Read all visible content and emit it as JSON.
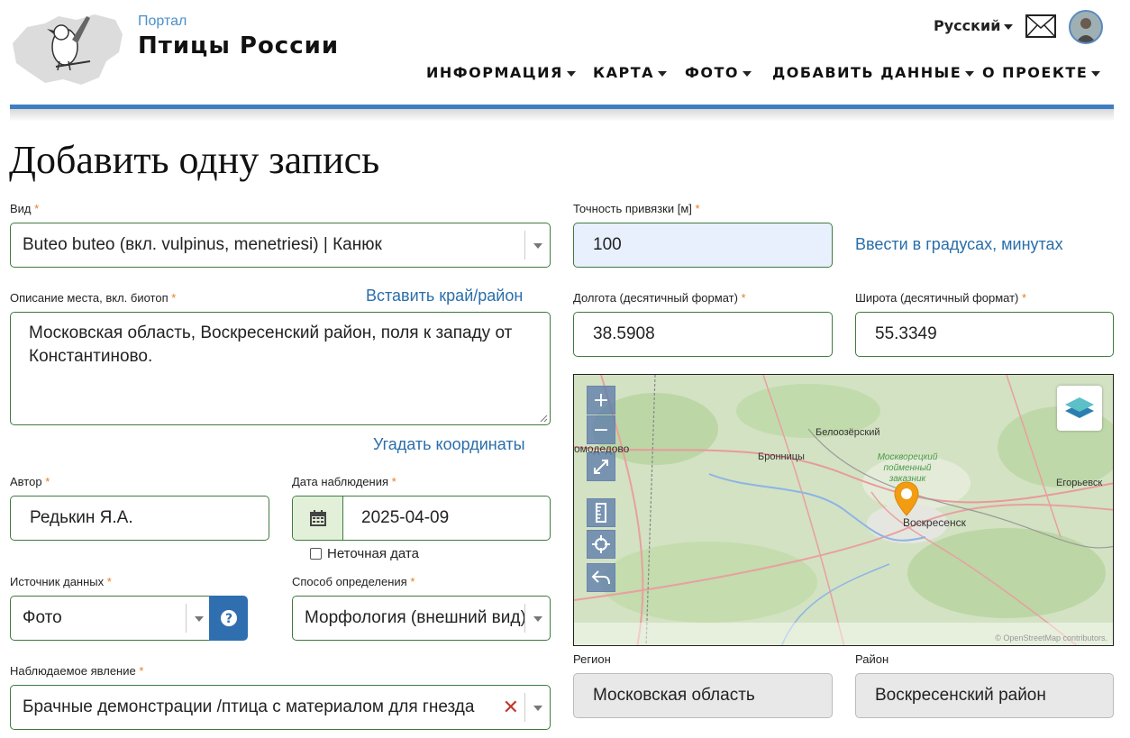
{
  "header": {
    "portal_label": "Портал",
    "site_title": "Птицы России",
    "language": "Русский",
    "nav": [
      "ИНФОРМАЦИЯ",
      "КАРТА",
      "ФОТО",
      "ДОБАВИТЬ ДАННЫЕ",
      "О ПРОЕКТЕ"
    ]
  },
  "page_title": "Добавить одну запись",
  "form": {
    "species": {
      "label": "Вид",
      "value": "Buteo buteo (вкл. vulpinus, menetriesi) | Канюк"
    },
    "place": {
      "label": "Описание места, вкл. биотоп",
      "insert_link": "Вставить край/район",
      "value": "Московская область, Воскресенский район, поля к западу от Константиново.",
      "guess_link": "Угадать координаты"
    },
    "author": {
      "label": "Автор",
      "value": "Редькин Я.А."
    },
    "date": {
      "label": "Дата наблюдения",
      "value": "2025-04-09",
      "inexact_label": "Неточная дата"
    },
    "source": {
      "label": "Источник данных",
      "value": "Фото"
    },
    "method": {
      "label": "Способ определения",
      "value": "Морфология (внешний вид)"
    },
    "phenomenon": {
      "label": "Наблюдаемое явление",
      "value": "Брачные демонстрации /птица с материалом для гнезда"
    },
    "accuracy": {
      "label": "Точность привязки [м]",
      "value": "100",
      "degrees_link": "Ввести в градусах, минутах"
    },
    "longitude": {
      "label": "Долгота (десятичный формат)",
      "value": "38.5908"
    },
    "latitude": {
      "label": "Широта (десятичный формат)",
      "value": "55.3349"
    },
    "region": {
      "label": "Регион",
      "value": "Московская область"
    },
    "district": {
      "label": "Район",
      "value": "Воскресенский район"
    }
  },
  "map": {
    "places": {
      "belo": "Белоозёрский",
      "bron": "Бронницы",
      "dom": "омодедово",
      "reserve": "Москворецкий пойменный заказник",
      "voskr": "Воскресенск",
      "egor": "Егорьевск"
    },
    "attribution": "© OpenStreetMap contributors."
  },
  "colors": {
    "accent": "#3e7ec2",
    "field_border": "#3f7a3f",
    "required": "#e67e22",
    "link": "#2a6eaa",
    "marker": "#f39c12"
  }
}
